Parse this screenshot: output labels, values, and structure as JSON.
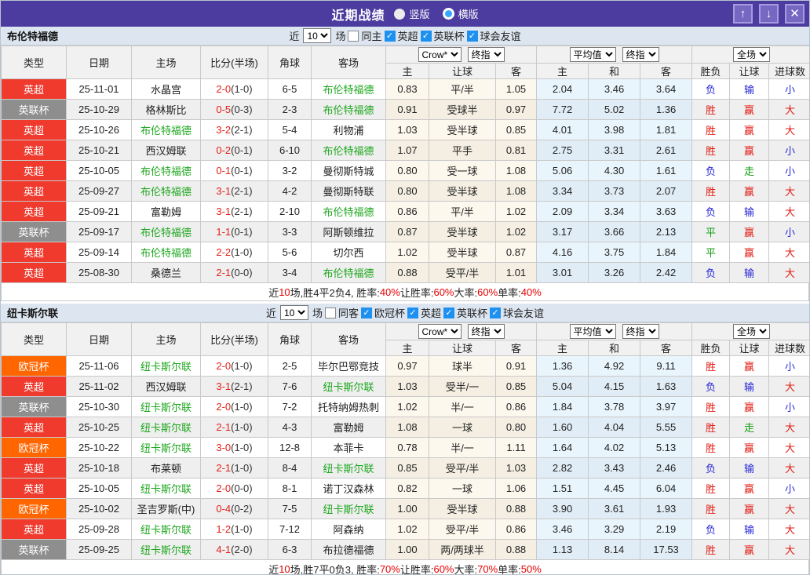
{
  "titlebar": {
    "title": "近期战绩",
    "radios": [
      {
        "label": "竖版",
        "selected": false
      },
      {
        "label": "横版",
        "selected": true
      }
    ],
    "buttons": {
      "up": "↑",
      "down": "↓",
      "close": "✕"
    }
  },
  "filter_labels": {
    "recent": "近",
    "matches": "场"
  },
  "columns": [
    "类型",
    "日期",
    "主场",
    "比分(半场)",
    "角球",
    "客场"
  ],
  "selects": {
    "bookmaker": "Crow*",
    "final1": "终指",
    "average": "平均值",
    "final2": "终指",
    "fulltime": "全场"
  },
  "odds_headers": [
    "主",
    "让球",
    "客"
  ],
  "avg_headers": [
    "主",
    "和",
    "客"
  ],
  "result_headers": [
    "胜负",
    "让球",
    "进球数"
  ],
  "sections": [
    {
      "team": "布伦特福德",
      "count": "10",
      "same_venue": {
        "label": "同主",
        "checked": false
      },
      "leagues": [
        {
          "label": "英超",
          "checked": true
        },
        {
          "label": "英联杯",
          "checked": true
        },
        {
          "label": "球会友谊",
          "checked": true
        }
      ],
      "rows": [
        {
          "type": "英超",
          "type_color": "red",
          "date": "25-11-01",
          "home": "水晶宫",
          "home_self": false,
          "score": "2-0",
          "half": "(1-0)",
          "corner": "6-5",
          "away": "布伦特福德",
          "away_self": true,
          "odds": [
            "0.83",
            "平/半",
            "1.05"
          ],
          "avg": [
            "2.04",
            "3.46",
            "3.64"
          ],
          "results": [
            {
              "t": "负",
              "c": "blue"
            },
            {
              "t": "输",
              "c": "blue"
            },
            {
              "t": "小",
              "c": "blue"
            }
          ]
        },
        {
          "type": "英联杯",
          "type_color": "gray",
          "date": "25-10-29",
          "home": "格林斯比",
          "home_self": false,
          "score": "0-5",
          "half": "(0-3)",
          "corner": "2-3",
          "away": "布伦特福德",
          "away_self": true,
          "odds": [
            "0.91",
            "受球半",
            "0.97"
          ],
          "avg": [
            "7.72",
            "5.02",
            "1.36"
          ],
          "results": [
            {
              "t": "胜",
              "c": "red"
            },
            {
              "t": "赢",
              "c": "red"
            },
            {
              "t": "大",
              "c": "red"
            }
          ]
        },
        {
          "type": "英超",
          "type_color": "red",
          "date": "25-10-26",
          "home": "布伦特福德",
          "home_self": true,
          "score": "3-2",
          "half": "(2-1)",
          "corner": "5-4",
          "away": "利物浦",
          "away_self": false,
          "odds": [
            "1.03",
            "受半球",
            "0.85"
          ],
          "avg": [
            "4.01",
            "3.98",
            "1.81"
          ],
          "results": [
            {
              "t": "胜",
              "c": "red"
            },
            {
              "t": "赢",
              "c": "red"
            },
            {
              "t": "大",
              "c": "red"
            }
          ]
        },
        {
          "type": "英超",
          "type_color": "red",
          "date": "25-10-21",
          "home": "西汉姆联",
          "home_self": false,
          "score": "0-2",
          "half": "(0-1)",
          "corner": "6-10",
          "away": "布伦特福德",
          "away_self": true,
          "odds": [
            "1.07",
            "平手",
            "0.81"
          ],
          "avg": [
            "2.75",
            "3.31",
            "2.61"
          ],
          "results": [
            {
              "t": "胜",
              "c": "red"
            },
            {
              "t": "赢",
              "c": "red"
            },
            {
              "t": "小",
              "c": "blue"
            }
          ]
        },
        {
          "type": "英超",
          "type_color": "red",
          "date": "25-10-05",
          "home": "布伦特福德",
          "home_self": true,
          "score": "0-1",
          "half": "(0-1)",
          "corner": "3-2",
          "away": "曼彻斯特城",
          "away_self": false,
          "odds": [
            "0.80",
            "受一球",
            "1.08"
          ],
          "avg": [
            "5.06",
            "4.30",
            "1.61"
          ],
          "results": [
            {
              "t": "负",
              "c": "blue"
            },
            {
              "t": "走",
              "c": "green"
            },
            {
              "t": "小",
              "c": "blue"
            }
          ]
        },
        {
          "type": "英超",
          "type_color": "red",
          "date": "25-09-27",
          "home": "布伦特福德",
          "home_self": true,
          "score": "3-1",
          "half": "(2-1)",
          "corner": "4-2",
          "away": "曼彻斯特联",
          "away_self": false,
          "odds": [
            "0.80",
            "受半球",
            "1.08"
          ],
          "avg": [
            "3.34",
            "3.73",
            "2.07"
          ],
          "results": [
            {
              "t": "胜",
              "c": "red"
            },
            {
              "t": "赢",
              "c": "red"
            },
            {
              "t": "大",
              "c": "red"
            }
          ]
        },
        {
          "type": "英超",
          "type_color": "red",
          "date": "25-09-21",
          "home": "富勒姆",
          "home_self": false,
          "score": "3-1",
          "half": "(2-1)",
          "corner": "2-10",
          "away": "布伦特福德",
          "away_self": true,
          "odds": [
            "0.86",
            "平/半",
            "1.02"
          ],
          "avg": [
            "2.09",
            "3.34",
            "3.63"
          ],
          "results": [
            {
              "t": "负",
              "c": "blue"
            },
            {
              "t": "输",
              "c": "blue"
            },
            {
              "t": "大",
              "c": "red"
            }
          ]
        },
        {
          "type": "英联杯",
          "type_color": "gray",
          "date": "25-09-17",
          "home": "布伦特福德",
          "home_self": true,
          "score": "1-1",
          "half": "(0-1)",
          "corner": "3-3",
          "away": "阿斯顿维拉",
          "away_self": false,
          "odds": [
            "0.87",
            "受半球",
            "1.02"
          ],
          "avg": [
            "3.17",
            "3.66",
            "2.13"
          ],
          "results": [
            {
              "t": "平",
              "c": "green"
            },
            {
              "t": "赢",
              "c": "red"
            },
            {
              "t": "小",
              "c": "blue"
            }
          ]
        },
        {
          "type": "英超",
          "type_color": "red",
          "date": "25-09-14",
          "home": "布伦特福德",
          "home_self": true,
          "score": "2-2",
          "half": "(1-0)",
          "corner": "5-6",
          "away": "切尔西",
          "away_self": false,
          "odds": [
            "1.02",
            "受半球",
            "0.87"
          ],
          "avg": [
            "4.16",
            "3.75",
            "1.84"
          ],
          "results": [
            {
              "t": "平",
              "c": "green"
            },
            {
              "t": "赢",
              "c": "red"
            },
            {
              "t": "大",
              "c": "red"
            }
          ]
        },
        {
          "type": "英超",
          "type_color": "red",
          "date": "25-08-30",
          "home": "桑德兰",
          "home_self": false,
          "score": "2-1",
          "half": "(0-0)",
          "corner": "3-4",
          "away": "布伦特福德",
          "away_self": true,
          "odds": [
            "0.88",
            "受平/半",
            "1.01"
          ],
          "avg": [
            "3.01",
            "3.26",
            "2.42"
          ],
          "results": [
            {
              "t": "负",
              "c": "blue"
            },
            {
              "t": "输",
              "c": "blue"
            },
            {
              "t": "大",
              "c": "red"
            }
          ]
        }
      ],
      "summary": [
        {
          "t": "近"
        },
        {
          "t": "10",
          "red": true
        },
        {
          "t": "场,胜4平2负4, 胜率:"
        },
        {
          "t": "40%",
          "red": true
        },
        {
          "t": " 让胜率:"
        },
        {
          "t": "60%",
          "red": true
        },
        {
          "t": " 大率:"
        },
        {
          "t": "60%",
          "red": true
        },
        {
          "t": " 单率:"
        },
        {
          "t": "40%",
          "red": true
        }
      ]
    },
    {
      "team": "纽卡斯尔联",
      "count": "10",
      "same_venue": {
        "label": "同客",
        "checked": false
      },
      "leagues": [
        {
          "label": "欧冠杯",
          "checked": true
        },
        {
          "label": "英超",
          "checked": true
        },
        {
          "label": "英联杯",
          "checked": true
        },
        {
          "label": "球会友谊",
          "checked": true
        }
      ],
      "rows": [
        {
          "type": "欧冠杯",
          "type_color": "orange",
          "date": "25-11-06",
          "home": "纽卡斯尔联",
          "home_self": true,
          "score": "2-0",
          "half": "(1-0)",
          "corner": "2-5",
          "away": "毕尔巴鄂竞技",
          "away_self": false,
          "odds": [
            "0.97",
            "球半",
            "0.91"
          ],
          "avg": [
            "1.36",
            "4.92",
            "9.11"
          ],
          "results": [
            {
              "t": "胜",
              "c": "red"
            },
            {
              "t": "赢",
              "c": "red"
            },
            {
              "t": "小",
              "c": "blue"
            }
          ]
        },
        {
          "type": "英超",
          "type_color": "red",
          "date": "25-11-02",
          "home": "西汉姆联",
          "home_self": false,
          "score": "3-1",
          "half": "(2-1)",
          "corner": "7-6",
          "away": "纽卡斯尔联",
          "away_self": true,
          "odds": [
            "1.03",
            "受半/一",
            "0.85"
          ],
          "avg": [
            "5.04",
            "4.15",
            "1.63"
          ],
          "results": [
            {
              "t": "负",
              "c": "blue"
            },
            {
              "t": "输",
              "c": "blue"
            },
            {
              "t": "大",
              "c": "red"
            }
          ]
        },
        {
          "type": "英联杯",
          "type_color": "gray",
          "date": "25-10-30",
          "home": "纽卡斯尔联",
          "home_self": true,
          "score": "2-0",
          "half": "(1-0)",
          "corner": "7-2",
          "away": "托特纳姆热刺",
          "away_self": false,
          "odds": [
            "1.02",
            "半/一",
            "0.86"
          ],
          "avg": [
            "1.84",
            "3.78",
            "3.97"
          ],
          "results": [
            {
              "t": "胜",
              "c": "red"
            },
            {
              "t": "赢",
              "c": "red"
            },
            {
              "t": "小",
              "c": "blue"
            }
          ]
        },
        {
          "type": "英超",
          "type_color": "red",
          "date": "25-10-25",
          "home": "纽卡斯尔联",
          "home_self": true,
          "score": "2-1",
          "half": "(1-0)",
          "corner": "4-3",
          "away": "富勒姆",
          "away_self": false,
          "odds": [
            "1.08",
            "一球",
            "0.80"
          ],
          "avg": [
            "1.60",
            "4.04",
            "5.55"
          ],
          "results": [
            {
              "t": "胜",
              "c": "red"
            },
            {
              "t": "走",
              "c": "green"
            },
            {
              "t": "大",
              "c": "red"
            }
          ]
        },
        {
          "type": "欧冠杯",
          "type_color": "orange",
          "date": "25-10-22",
          "home": "纽卡斯尔联",
          "home_self": true,
          "score": "3-0",
          "half": "(1-0)",
          "corner": "12-8",
          "away": "本菲卡",
          "away_self": false,
          "odds": [
            "0.78",
            "半/一",
            "1.11"
          ],
          "avg": [
            "1.64",
            "4.02",
            "5.13"
          ],
          "results": [
            {
              "t": "胜",
              "c": "red"
            },
            {
              "t": "赢",
              "c": "red"
            },
            {
              "t": "大",
              "c": "red"
            }
          ]
        },
        {
          "type": "英超",
          "type_color": "red",
          "date": "25-10-18",
          "home": "布莱顿",
          "home_self": false,
          "score": "2-1",
          "half": "(1-0)",
          "corner": "8-4",
          "away": "纽卡斯尔联",
          "away_self": true,
          "odds": [
            "0.85",
            "受平/半",
            "1.03"
          ],
          "avg": [
            "2.82",
            "3.43",
            "2.46"
          ],
          "results": [
            {
              "t": "负",
              "c": "blue"
            },
            {
              "t": "输",
              "c": "blue"
            },
            {
              "t": "大",
              "c": "red"
            }
          ]
        },
        {
          "type": "英超",
          "type_color": "red",
          "date": "25-10-05",
          "home": "纽卡斯尔联",
          "home_self": true,
          "score": "2-0",
          "half": "(0-0)",
          "corner": "8-1",
          "away": "诺丁汉森林",
          "away_self": false,
          "odds": [
            "0.82",
            "一球",
            "1.06"
          ],
          "avg": [
            "1.51",
            "4.45",
            "6.04"
          ],
          "results": [
            {
              "t": "胜",
              "c": "red"
            },
            {
              "t": "赢",
              "c": "red"
            },
            {
              "t": "小",
              "c": "blue"
            }
          ]
        },
        {
          "type": "欧冠杯",
          "type_color": "orange",
          "date": "25-10-02",
          "home": "圣吉罗斯(中)",
          "home_self": false,
          "score": "0-4",
          "half": "(0-2)",
          "corner": "7-5",
          "away": "纽卡斯尔联",
          "away_self": true,
          "odds": [
            "1.00",
            "受半球",
            "0.88"
          ],
          "avg": [
            "3.90",
            "3.61",
            "1.93"
          ],
          "results": [
            {
              "t": "胜",
              "c": "red"
            },
            {
              "t": "赢",
              "c": "red"
            },
            {
              "t": "大",
              "c": "red"
            }
          ]
        },
        {
          "type": "英超",
          "type_color": "red",
          "date": "25-09-28",
          "home": "纽卡斯尔联",
          "home_self": true,
          "score": "1-2",
          "half": "(1-0)",
          "corner": "7-12",
          "away": "阿森纳",
          "away_self": false,
          "odds": [
            "1.02",
            "受平/半",
            "0.86"
          ],
          "avg": [
            "3.46",
            "3.29",
            "2.19"
          ],
          "results": [
            {
              "t": "负",
              "c": "blue"
            },
            {
              "t": "输",
              "c": "blue"
            },
            {
              "t": "大",
              "c": "red"
            }
          ]
        },
        {
          "type": "英联杯",
          "type_color": "gray",
          "date": "25-09-25",
          "home": "纽卡斯尔联",
          "home_self": true,
          "score": "4-1",
          "half": "(2-0)",
          "corner": "6-3",
          "away": "布拉德福德",
          "away_self": false,
          "odds": [
            "1.00",
            "两/两球半",
            "0.88"
          ],
          "avg": [
            "1.13",
            "8.14",
            "17.53"
          ],
          "results": [
            {
              "t": "胜",
              "c": "red"
            },
            {
              "t": "赢",
              "c": "red"
            },
            {
              "t": "大",
              "c": "red"
            }
          ]
        }
      ],
      "summary": [
        {
          "t": "近"
        },
        {
          "t": "10",
          "red": true
        },
        {
          "t": "场,胜7平0负3, 胜率:"
        },
        {
          "t": "70%",
          "red": true
        },
        {
          "t": " 让胜率:"
        },
        {
          "t": "60%",
          "red": true
        },
        {
          "t": " 大率:"
        },
        {
          "t": "70%",
          "red": true
        },
        {
          "t": " 单率:"
        },
        {
          "t": "50%",
          "red": true
        }
      ]
    }
  ]
}
